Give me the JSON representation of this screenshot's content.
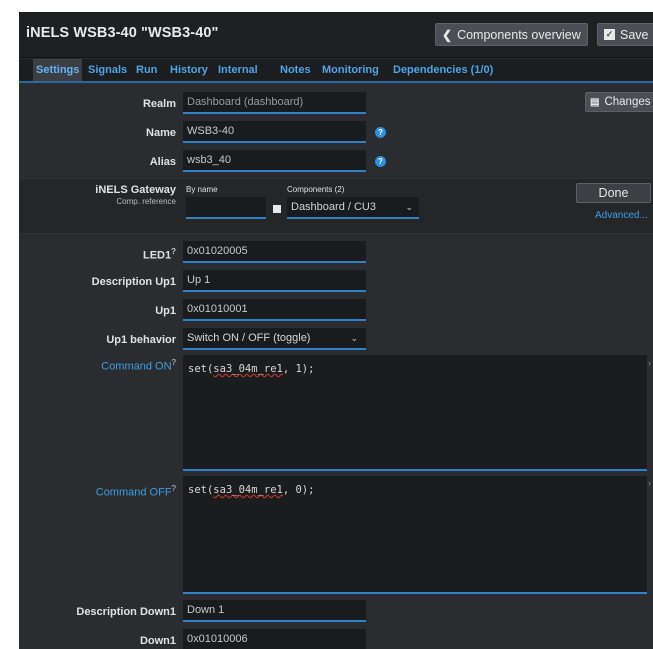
{
  "header": {
    "title": "iNELS WSB3-40 \"WSB3-40\"",
    "components_overview_label": "Components overview",
    "save_label": "Save"
  },
  "tabs": [
    "Settings",
    "Signals",
    "Run",
    "History",
    "Internal",
    "Notes",
    "Monitoring",
    "Dependencies (1/0)"
  ],
  "form": {
    "realm_label": "Realm",
    "realm_value": "Dashboard (dashboard)",
    "changes_label": "Changes",
    "name_label": "Name",
    "name_value": "WSB3-40",
    "alias_label": "Alias",
    "alias_value": "wsb3_40",
    "gateway_label": "iNELS Gateway",
    "gateway_sub": "Comp. reference",
    "by_name_label": "By name",
    "components_label": "Components (2)",
    "component_selected": "Dashboard / CU3",
    "done_label": "Done",
    "advanced_label": "Advanced...",
    "led1_label": "LED1",
    "led1_value": "0x01020005",
    "desc_up1_label": "Description Up1",
    "desc_up1_value": "Up 1",
    "up1_label": "Up1",
    "up1_value": "0x01010001",
    "up1_behavior_label": "Up1 behavior",
    "up1_behavior_value": "Switch ON / OFF (toggle)",
    "cmd_on_label": "Command ON",
    "cmd_on_fn": "set(",
    "cmd_on_arg": "sa3_04m_re1",
    "cmd_on_rest": ", 1);",
    "cmd_off_label": "Command OFF",
    "cmd_off_fn": "set(",
    "cmd_off_arg": "sa3_04m_re1",
    "cmd_off_rest": ", 0);",
    "desc_down1_label": "Description Down1",
    "desc_down1_value": "Down 1",
    "down1_label": "Down1",
    "down1_value": "0x01010006",
    "hint_mark": "?"
  },
  "colors": {
    "accent": "#2e82c7",
    "tab_text": "#4aa6e8",
    "background": "#2a2c2f"
  }
}
